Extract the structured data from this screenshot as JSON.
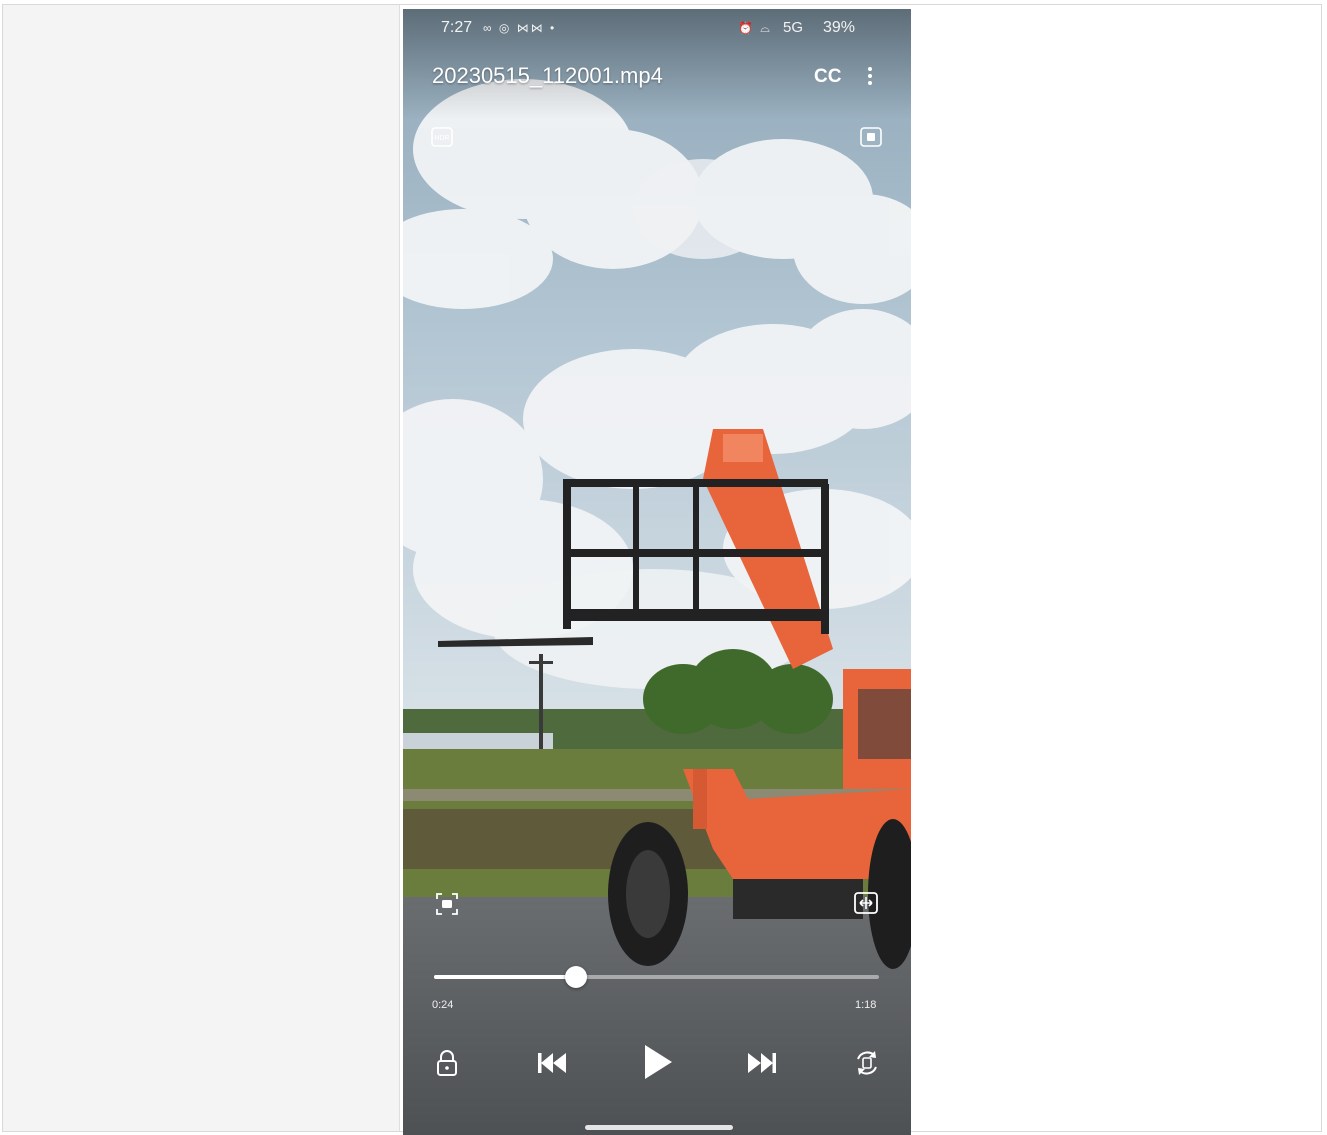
{
  "status_bar": {
    "time": "7:27",
    "left_icons": "∞ ◎ ⋈⋈ •",
    "right_icons": "⏰ ⌓",
    "network": "5G",
    "battery": "39%"
  },
  "player": {
    "file_name": "20230515_112001.mp4",
    "cc_label": "CC",
    "current_time": "0:24",
    "total_time": "1:18",
    "progress_fraction": 0.32
  },
  "icons": {
    "hdr": "hdr-icon",
    "pip": "pip-icon",
    "screenshot": "screenshot-icon",
    "fit": "fit-screen-icon",
    "lock": "lock-icon",
    "prev": "previous-icon",
    "play": "play-icon",
    "next": "next-icon",
    "rotate": "rotate-icon"
  },
  "colors": {
    "machine_orange": "#e8643a",
    "sky": "#b9cbd6"
  }
}
